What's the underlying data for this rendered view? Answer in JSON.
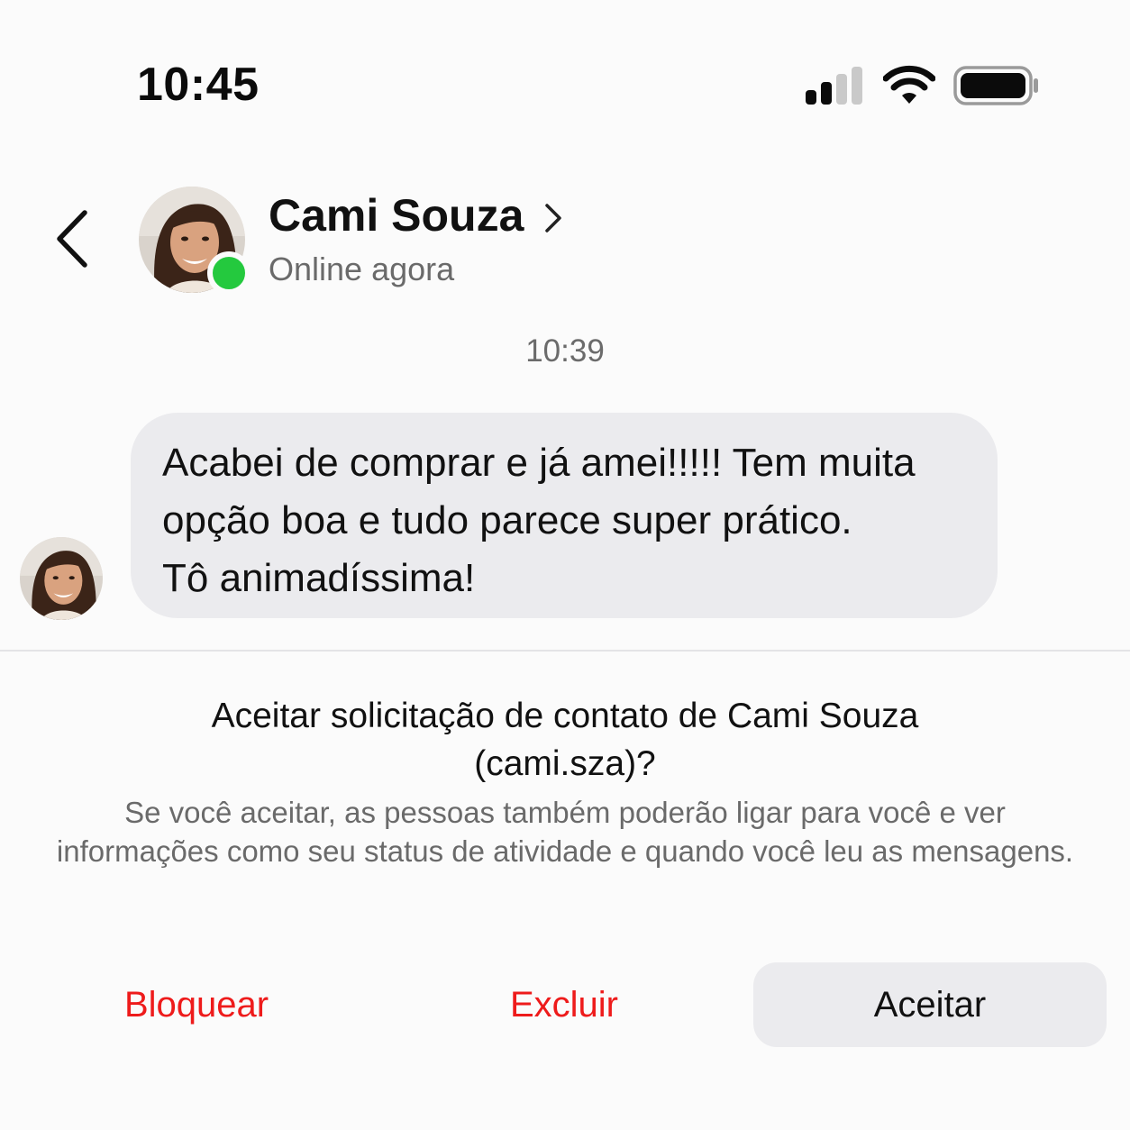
{
  "status_bar": {
    "time": "10:45"
  },
  "header": {
    "contact_name": "Cami Souza",
    "contact_status": "Online agora"
  },
  "chat": {
    "timestamp": "10:39",
    "messages": [
      {
        "text": "Acabei de comprar e já amei!!!!! Tem muita\nopção boa e tudo parece super prático.\nTô animadíssima!"
      }
    ]
  },
  "request": {
    "title": "Aceitar solicitação de contato de Cami Souza (cami.sza)?",
    "description": "Se você aceitar, as pessoas também poderão ligar para você e ver informações como seu status de atividade e quando você leu as mensagens."
  },
  "actions": {
    "block_label": "Bloquear",
    "delete_label": "Excluir",
    "accept_label": "Aceitar"
  },
  "colors": {
    "online": "#24c93e",
    "danger": "#ee1b1b",
    "bubble": "#ebebee"
  }
}
